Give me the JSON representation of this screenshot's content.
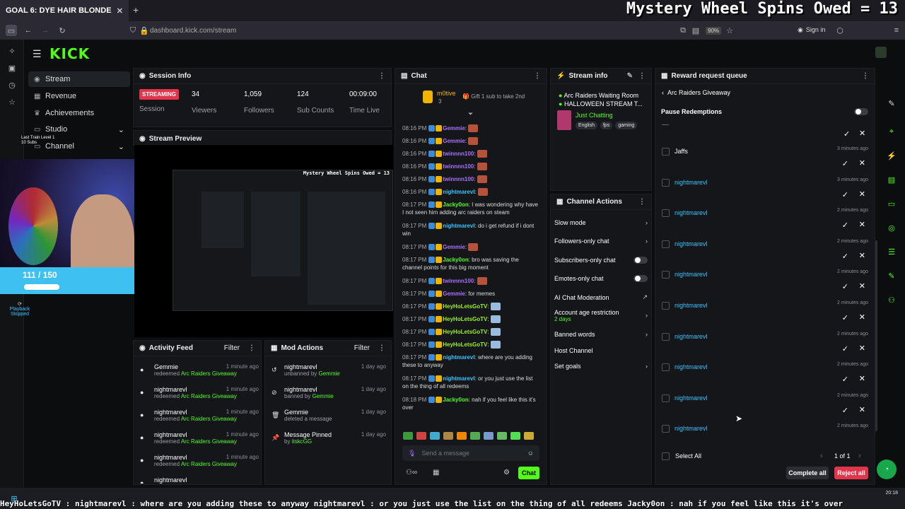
{
  "browser": {
    "tab_title": "GOAL 6: DYE HAIR BLONDE",
    "url": "dashboard.kick.com/stream",
    "zoom": "90%",
    "sign_in": "Sign in"
  },
  "overlay_title": "Mystery Wheel Spins Owed = 13",
  "logo": "KICK",
  "nav": [
    {
      "label": "Stream",
      "icon": "stream-icon"
    },
    {
      "label": "Revenue",
      "icon": "revenue-icon"
    },
    {
      "label": "Achievements",
      "icon": "trophy-icon"
    },
    {
      "label": "Studio",
      "icon": "studio-icon"
    },
    {
      "label": "Channel",
      "icon": "channel-icon"
    }
  ],
  "session": {
    "title": "Session Info",
    "status": "STREAMING",
    "status_label": "Session",
    "stats": [
      {
        "value": "34",
        "label": "Viewers"
      },
      {
        "value": "1,059",
        "label": "Followers"
      },
      {
        "value": "124",
        "label": "Sub Counts"
      },
      {
        "value": "00:09:00",
        "label": "Time Live"
      }
    ]
  },
  "preview": {
    "title": "Stream Preview",
    "inner_title": "Mystery Wheel Spins Owed = 13"
  },
  "webcam": {
    "progress_text": "111 / 150",
    "playback": "Playback Stopped",
    "train": "Last Train Level 1",
    "subs": "10 Subs"
  },
  "chat": {
    "title": "Chat",
    "gifter": "m0tive",
    "gifter_count": "3",
    "gift_text": "Gift 1 sub to take 2nd",
    "placeholder": "Send a message",
    "send": "Chat",
    "lines": [
      {
        "time": "08:16 PM",
        "user": "Gemmie",
        "color": "n-purple",
        "text": ""
      },
      {
        "time": "08:16 PM",
        "user": "Gemmie",
        "color": "n-purple",
        "text": ""
      },
      {
        "time": "08:16 PM",
        "user": "twinnnn100",
        "color": "n-purple",
        "text": ""
      },
      {
        "time": "08:16 PM",
        "user": "twinnnn100",
        "color": "n-purple",
        "text": ""
      },
      {
        "time": "08:16 PM",
        "user": "twinnnn100",
        "color": "n-purple",
        "text": ""
      },
      {
        "time": "08:16 PM",
        "user": "nightmarevl",
        "color": "n-blue",
        "text": ""
      },
      {
        "time": "08:17 PM",
        "user": "Jacky0on",
        "color": "n-green",
        "text": "I was wondering why have I not seen him adding arc raiders on steam"
      },
      {
        "time": "08:17 PM",
        "user": "nightmarevl",
        "color": "n-blue",
        "text": "do i get refund if i dont win"
      },
      {
        "time": "08:17 PM",
        "user": "Gemmie",
        "color": "n-purple",
        "text": ""
      },
      {
        "time": "08:17 PM",
        "user": "Jacky0on",
        "color": "n-green",
        "text": "bro was saving the channel points for this big moment"
      },
      {
        "time": "08:17 PM",
        "user": "twinnnn100",
        "color": "n-purple",
        "text": ""
      },
      {
        "time": "08:17 PM",
        "user": "Gemmie",
        "color": "n-purple",
        "text": "for memes"
      },
      {
        "time": "08:17 PM",
        "user": "HeyHoLetsGoTV",
        "color": "n-lime",
        "text": ""
      },
      {
        "time": "08:17 PM",
        "user": "HeyHoLetsGoTV",
        "color": "n-lime",
        "text": ""
      },
      {
        "time": "08:17 PM",
        "user": "HeyHoLetsGoTV",
        "color": "n-lime",
        "text": ""
      },
      {
        "time": "08:17 PM",
        "user": "HeyHoLetsGoTV",
        "color": "n-lime",
        "text": ""
      },
      {
        "time": "08:17 PM",
        "user": "nightmarevl",
        "color": "n-blue",
        "text": "where are you adding these to anyway"
      },
      {
        "time": "08:17 PM",
        "user": "nightmarevl",
        "color": "n-blue",
        "text": "or you just use the list on the thing of all redeems"
      },
      {
        "time": "08:18 PM",
        "user": "Jacky0on",
        "color": "n-green",
        "text": "nah if you feel like this it's over"
      }
    ]
  },
  "stream_info": {
    "title": "Stream info",
    "line1": "Arc Raiders Waiting Room",
    "line2": "HALLOWEEN STREAM T...",
    "category": "Just Chatting",
    "tags": [
      "English",
      "fps",
      "gaming"
    ]
  },
  "channel_actions": {
    "title": "Channel Actions",
    "items": [
      {
        "label": "Slow mode",
        "type": "chev"
      },
      {
        "label": "Followers-only chat",
        "type": "chev"
      },
      {
        "label": "Subscribers-only chat",
        "type": "toggle"
      },
      {
        "label": "Emotes-only chat",
        "type": "toggle"
      },
      {
        "label": "AI Chat Moderation",
        "type": "ext"
      },
      {
        "label": "Account age restriction",
        "type": "chev",
        "sub": "2 days"
      },
      {
        "label": "Banned words",
        "type": "chev"
      },
      {
        "label": "Host Channel",
        "type": "none"
      },
      {
        "label": "Set goals",
        "type": "chev"
      }
    ]
  },
  "activity": {
    "title": "Activity Feed",
    "filter": "Filter",
    "items": [
      {
        "name": "Gemmie",
        "verb": "redeemed",
        "target": "Arc Raiders Giveaway",
        "time": "1 minute ago"
      },
      {
        "name": "nightmarevl",
        "verb": "redeemed",
        "target": "Arc Raiders Giveaway",
        "time": "1 minute ago"
      },
      {
        "name": "nightmarevl",
        "verb": "redeemed",
        "target": "Arc Raiders Giveaway",
        "time": "1 minute ago"
      },
      {
        "name": "nightmarevl",
        "verb": "redeemed",
        "target": "Arc Raiders Giveaway",
        "time": "1 minute ago"
      },
      {
        "name": "nightmarevl",
        "verb": "redeemed",
        "target": "Arc Raiders Giveaway",
        "time": "1 minute ago"
      },
      {
        "name": "nightmarevl",
        "verb": "",
        "target": "",
        "time": ""
      }
    ]
  },
  "mod": {
    "title": "Mod Actions",
    "filter": "Filter",
    "items": [
      {
        "name": "nightmarevl",
        "verb": "unbanned by",
        "by": "Gemmie",
        "time": "1 day ago",
        "icon": "unban-icon"
      },
      {
        "name": "nightmarevl",
        "verb": "banned by",
        "by": "Gemmie",
        "time": "1 day ago",
        "icon": "ban-icon"
      },
      {
        "name": "Gemmie",
        "verb": "deleted a message",
        "by": "",
        "time": "1 day ago",
        "icon": "trash-icon"
      },
      {
        "name": "Message Pinned",
        "verb": "by",
        "by": "itskcGG",
        "time": "1 day ago",
        "icon": "pin-icon"
      }
    ]
  },
  "rewards": {
    "title": "Reward request queue",
    "back_label": "Arc Raiders Giveaway",
    "pause": "Pause Redemptions",
    "items": [
      {
        "name": "Jaffs",
        "time": "3 minutes ago",
        "color": "#ffffff"
      },
      {
        "name": "nightmarevl",
        "time": "3 minutes ago",
        "color": "#34c3ff"
      },
      {
        "name": "nightmarevl",
        "time": "2 minutes ago",
        "color": "#34c3ff"
      },
      {
        "name": "nightmarevl",
        "time": "2 minutes ago",
        "color": "#34c3ff"
      },
      {
        "name": "nightmarevl",
        "time": "2 minutes ago",
        "color": "#34c3ff"
      },
      {
        "name": "nightmarevl",
        "time": "2 minutes ago",
        "color": "#34c3ff"
      },
      {
        "name": "nightmarevl",
        "time": "2 minutes ago",
        "color": "#34c3ff"
      },
      {
        "name": "nightmarevl",
        "time": "2 minutes ago",
        "color": "#34c3ff"
      },
      {
        "name": "nightmarevl",
        "time": "2 minutes ago",
        "color": "#34c3ff"
      },
      {
        "name": "nightmarevl",
        "time": "2 minutes ago",
        "color": "#34c3ff"
      }
    ],
    "select_all": "Select All",
    "page": "1 of 1",
    "complete": "Complete all",
    "reject": "Reject all"
  },
  "ticker": "HeyHoLetsGoTV :  nightmarevl : where are you adding these to anyway  nightmarevl : or you just use the list on the thing of all redeems  Jacky0on : nah if you feel like this it's over",
  "clock": "20:18",
  "colors": {
    "accent": "#53fc18",
    "danger": "#e2354b"
  }
}
